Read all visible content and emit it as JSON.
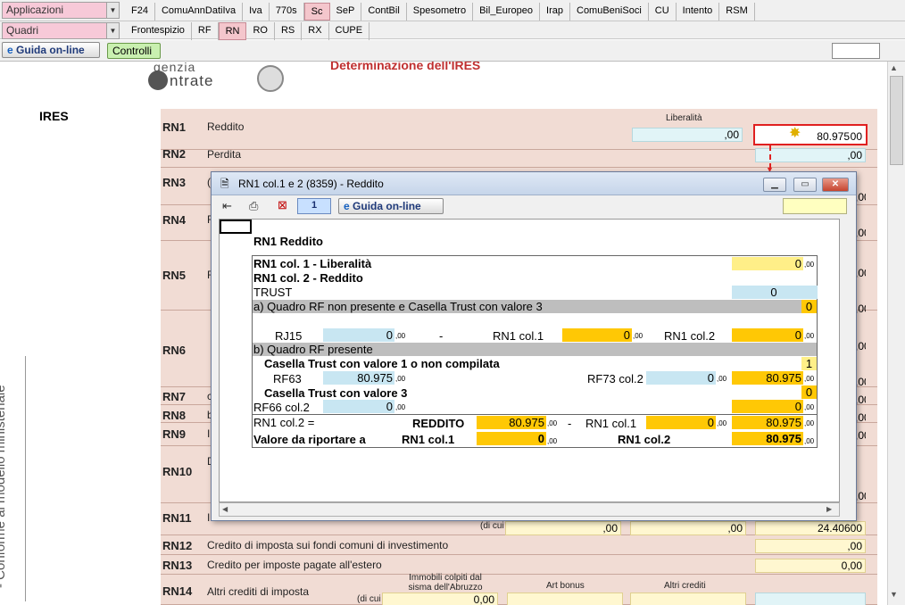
{
  "menus": {
    "applicazioni": "Applicazioni",
    "quadri": "Quadri"
  },
  "top_tabs": [
    "F24",
    "ComuAnnDatiIva",
    "Iva",
    "770s",
    "Sc",
    "SeP",
    "ContBil",
    "Spesometro",
    "Bil_Europeo",
    "Irap",
    "ComuBeniSoci",
    "CU",
    "Intento",
    "RSM"
  ],
  "sub_tabs": [
    "Frontespizio",
    "RF",
    "RN",
    "RO",
    "RS",
    "RX",
    "CUPE"
  ],
  "toolbar": {
    "guida_label": "Guida on-line",
    "controlli_label": "Controlli",
    "page_number": "1"
  },
  "doc": {
    "logo_top": "genzia",
    "logo_bottom": "ntrate",
    "title": "Determinazione dell'IRES",
    "section": "IRES",
    "side_text": "- Conforme al modello ministeriale",
    "liberalita_header": "Liberalità",
    "rows": [
      {
        "code": "RN1",
        "label": "Reddito"
      },
      {
        "code": "RN2",
        "label": "Perdita"
      },
      {
        "code": "RN3",
        "label": "("
      },
      {
        "code": "RN4",
        "label": "F"
      },
      {
        "code": "RN5",
        "label": "F"
      },
      {
        "code": "RN6",
        "label": ""
      },
      {
        "code": "RN7",
        "label": "c"
      },
      {
        "code": "RN8",
        "label": "b"
      },
      {
        "code": "RN9",
        "label": "I"
      },
      {
        "code": "RN10",
        "label": "D"
      },
      {
        "code": "RN11",
        "label": "I"
      },
      {
        "code": "RN12",
        "label": "Credito di imposta sui fondi comuni di investimento"
      },
      {
        "code": "RN13",
        "label": "Credito per imposte pagate all'estero"
      },
      {
        "code": "RN14",
        "label": "Altri crediti di imposta"
      }
    ],
    "rn1_col1_value": ",00",
    "rn1_col2_value": "80.975",
    "rn1_col2_dec": "00",
    "rn2_value": ",00",
    "right_values": [
      ",00",
      ",00",
      ",00",
      ",00",
      ",00",
      ",00",
      ",00",
      ",00",
      ",00",
      ",00"
    ],
    "rn11_di_cui": "(di cui",
    "rn11_v1": ",00",
    "rn11_v2": ",00",
    "rn11_total": "24.406",
    "rn11_total_dec": "00",
    "rn12_value": ",00",
    "rn13_value": "0,00",
    "rn14_col1_head": "Immobili colpiti dal sisma dell'Abruzzo",
    "rn14_col2_head": "Art bonus",
    "rn14_col3_head": "Altri crediti",
    "rn14_di_cui": "(di cui",
    "rn14_v1": "0,00"
  },
  "modal": {
    "title": "RN1 col.1 e 2 (8359) - Reddito",
    "page_number": "1",
    "guida_label": "Guida on-line",
    "heading": "RN1 Reddito",
    "col1_label": "RN1 col. 1 - Liberalità",
    "col1_value": "0",
    "col2_label": "RN1 col. 2 - Reddito",
    "trust_label": "TRUST",
    "trust_value": "0",
    "sec_a_label": "a) Quadro RF non presente e Casella Trust con valore 3",
    "sec_a_flag": "0",
    "rj15_label": "RJ15",
    "rj15_value": "0",
    "minus": "-",
    "a_rn1col1_label": "RN1 col.1",
    "a_rn1col1_value": "0",
    "a_rn1col2_label": "RN1 col.2",
    "a_rn1col2_value": "0",
    "sec_b_label": "b) Quadro RF presente",
    "trust13_label": "Casella Trust con valore 1 o non compilata",
    "trust13_flag": "1",
    "rf63_label": "RF63",
    "rf63_value": "80.975",
    "rf73_label": "RF73 col.2",
    "rf73_value": "0",
    "b1_result": "80.975",
    "trust3_label": "Casella Trust con valore 3",
    "trust3_flag": "0",
    "rf66_label": "RF66 col.2",
    "rf66_value": "0",
    "b3_result": "0",
    "rn1col2_eq_label": "RN1 col.2 =",
    "reddito_label": "REDDITO",
    "reddito_value": "80.975",
    "eq_minus": "-",
    "eq_rn1col1_label": "RN1 col.1",
    "eq_rn1col1_value": "0",
    "eq_result": "80.975",
    "valore_label": "Valore da riportare a",
    "final_col1_label": "RN1 col.1",
    "final_col1_value": "0",
    "final_col2_label": "RN1 col.2",
    "final_col2_value": "80.975",
    "dec": ",00"
  }
}
